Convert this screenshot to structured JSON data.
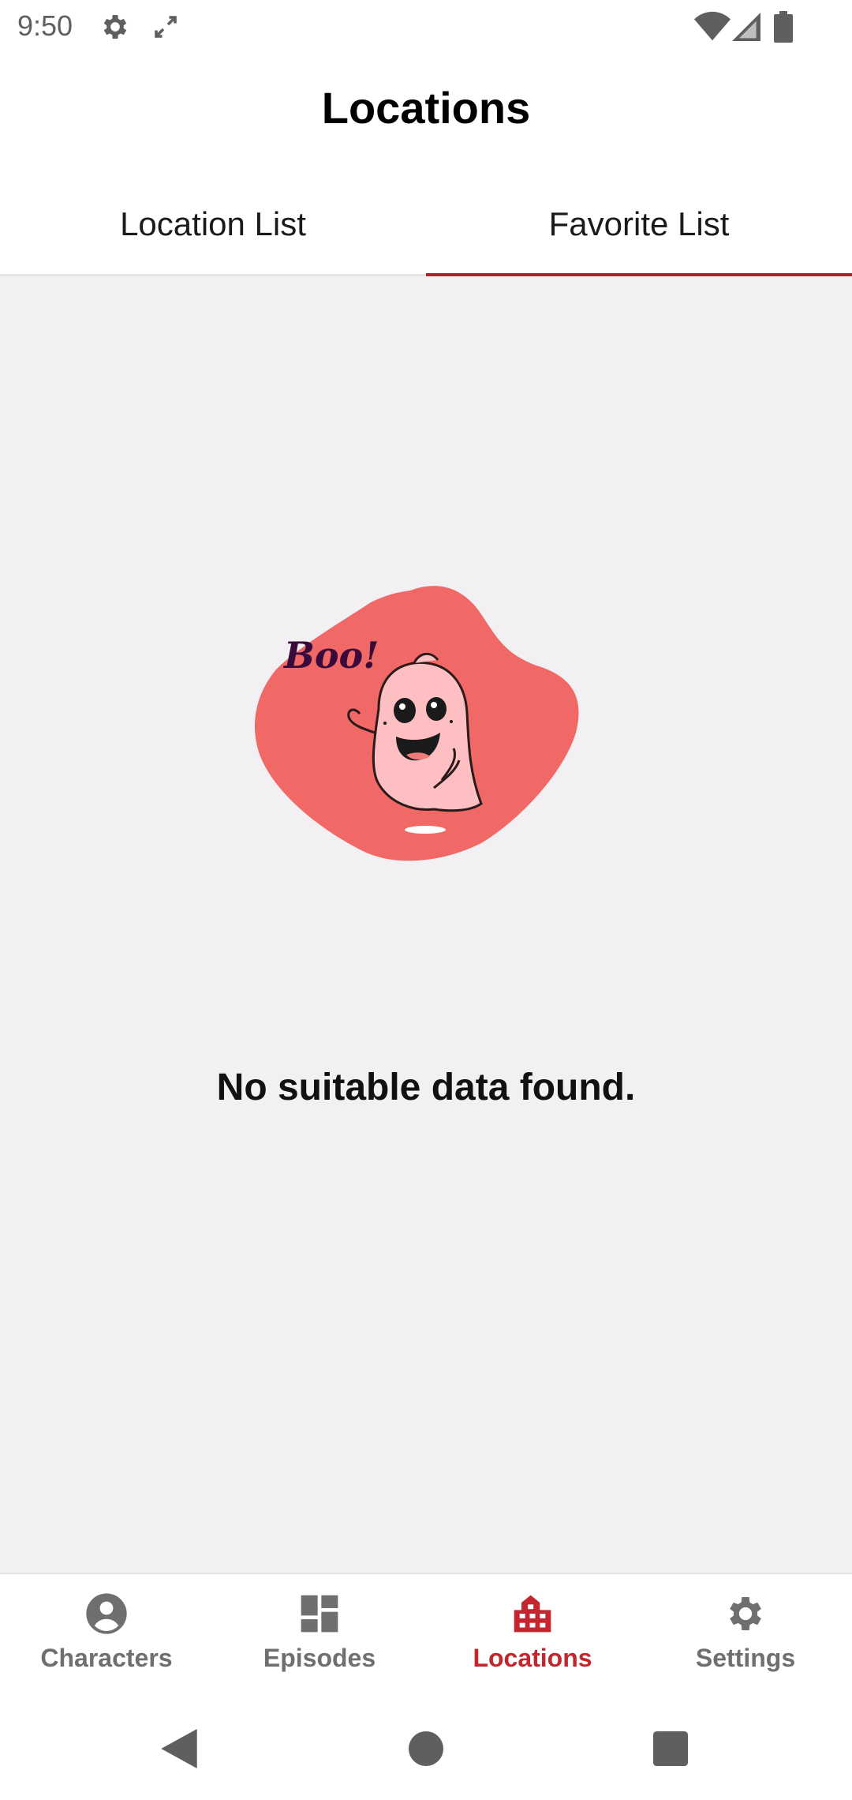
{
  "status_bar": {
    "time": "9:50",
    "left_icons": [
      "gear-icon",
      "rotate-icon"
    ],
    "right_icons": [
      "wifi-icon",
      "signal-icon",
      "battery-icon"
    ]
  },
  "app_bar": {
    "title": "Locations"
  },
  "tabs": [
    {
      "label": "Location List",
      "selected": false
    },
    {
      "label": "Favorite List",
      "selected": true
    }
  ],
  "empty_state": {
    "illustration_text": "Boo!",
    "message": "No suitable data found."
  },
  "bottom_nav": [
    {
      "label": "Characters",
      "icon": "person-icon",
      "active": false
    },
    {
      "label": "Episodes",
      "icon": "dashboard-icon",
      "active": false
    },
    {
      "label": "Locations",
      "icon": "city-icon",
      "active": true
    },
    {
      "label": "Settings",
      "icon": "gear-icon",
      "active": false
    }
  ],
  "system_nav": [
    "back-icon",
    "home-icon",
    "recents-icon"
  ],
  "colors": {
    "accent": "#c4262e",
    "tab_indicator": "#a8232b",
    "content_background": "#f3f0f4",
    "blob": "#f06966",
    "ghost": "#fdbfc2"
  }
}
